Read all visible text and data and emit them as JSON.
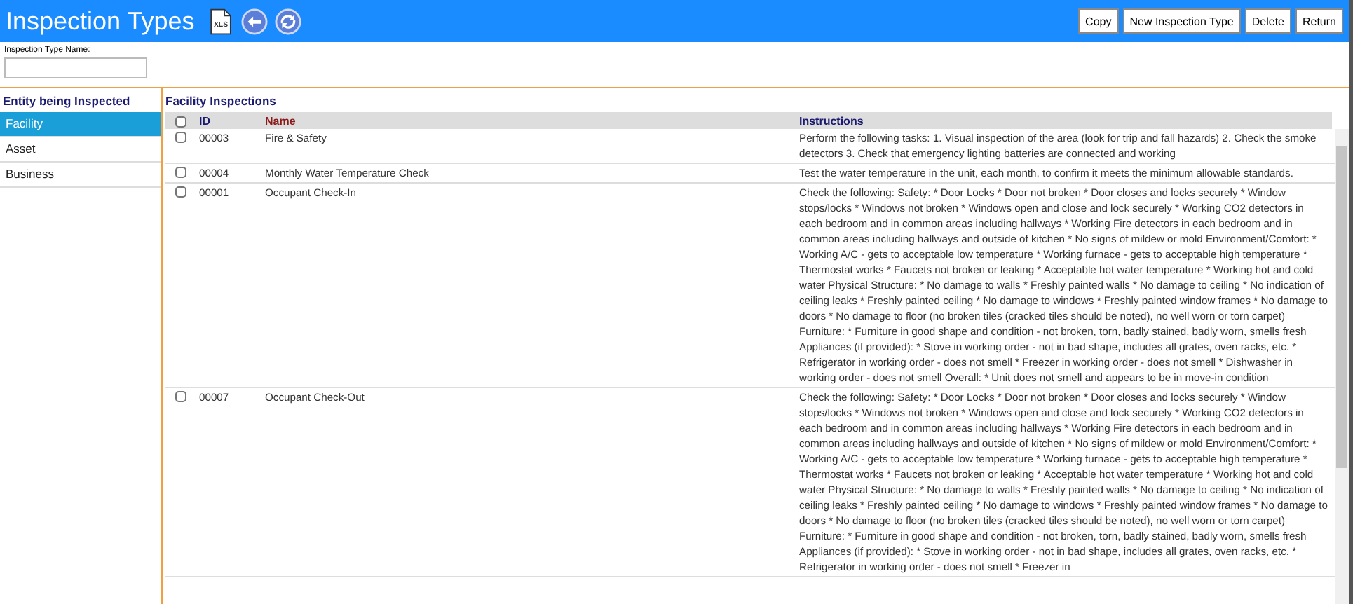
{
  "window": {
    "title": "Inspection Types"
  },
  "toolbar_buttons": [
    "Copy",
    "New Inspection Type",
    "Delete",
    "Return"
  ],
  "export_icon_label": "XLS",
  "name_field": {
    "label": "Inspection Type Name:"
  },
  "sidebar": {
    "title": "Entity being Inspected",
    "items": [
      {
        "label": "Facility",
        "selected": true
      },
      {
        "label": "Asset",
        "selected": false
      },
      {
        "label": "Business",
        "selected": false
      }
    ]
  },
  "table": {
    "title": "Facility Inspections",
    "header_checked": false,
    "columns": [
      "ID",
      "Name",
      "Instructions"
    ],
    "rows": [
      {
        "checked": false,
        "id": "00003",
        "name": "Fire & Safety",
        "instructions": "Perform the following tasks: 1. Visual inspection of the area (look for trip and fall hazards) 2. Check the smoke detectors 3. Check that emergency lighting batteries are connected and working"
      },
      {
        "checked": false,
        "id": "00004",
        "name": "Monthly Water Temperature Check",
        "instructions": "Test the water temperature in the unit, each month, to confirm it meets the minimum allowable standards."
      },
      {
        "checked": false,
        "id": "00001",
        "name": "Occupant Check-In",
        "instructions": "Check the following: Safety: * Door Locks * Door not broken * Door closes and locks securely * Window stops/locks * Windows not broken * Windows open and close and lock securely * Working CO2 detectors in each bedroom and in common areas including hallways * Working Fire detectors in each bedroom and in common areas including hallways and outside of kitchen * No signs of mildew or mold Environment/Comfort: * Working A/C - gets to acceptable low temperature * Working furnace - gets to acceptable high temperature * Thermostat works * Faucets not broken or leaking * Acceptable hot water temperature * Working hot and cold water Physical Structure: * No damage to walls * Freshly painted walls * No damage to ceiling * No indication of ceiling leaks * Freshly painted ceiling * No damage to windows * Freshly painted window frames * No damage to doors * No damage to floor (no broken tiles (cracked tiles should be noted), no well worn or torn carpet) Furniture: * Furniture in good shape and condition - not broken, torn, badly stained, badly worn, smells fresh Appliances (if provided): * Stove in working order - not in bad shape, includes all grates, oven racks, etc. * Refrigerator in working order - does not smell * Freezer in working order - does not smell * Dishwasher in working order - does not smell Overall: * Unit does not smell and appears to be in move-in condition"
      },
      {
        "checked": false,
        "id": "00007",
        "name": "Occupant Check-Out",
        "instructions": "Check the following: Safety: * Door Locks * Door not broken * Door closes and locks securely * Window stops/locks * Windows not broken * Windows open and close and lock securely * Working CO2 detectors in each bedroom and in common areas including hallways * Working Fire detectors in each bedroom and in common areas including hallways and outside of kitchen * No signs of mildew or mold Environment/Comfort: * Working A/C - gets to acceptable low temperature * Working furnace - gets to acceptable high temperature * Thermostat works * Faucets not broken or leaking * Acceptable hot water temperature * Working hot and cold water Physical Structure: * No damage to walls * Freshly painted walls * No damage to ceiling * No indication of ceiling leaks * Freshly painted ceiling * No damage to windows * Freshly painted window frames * No damage to doors * No damage to floor (no broken tiles (cracked tiles should be noted), no well worn or torn carpet) Furniture: * Furniture in good shape and condition - not broken, torn, badly stained, badly worn, smells fresh Appliances (if provided): * Stove in working order - not in bad shape, includes all grates, oven racks, etc. * Refrigerator in working order - does not smell * Freezer in"
      }
    ]
  }
}
